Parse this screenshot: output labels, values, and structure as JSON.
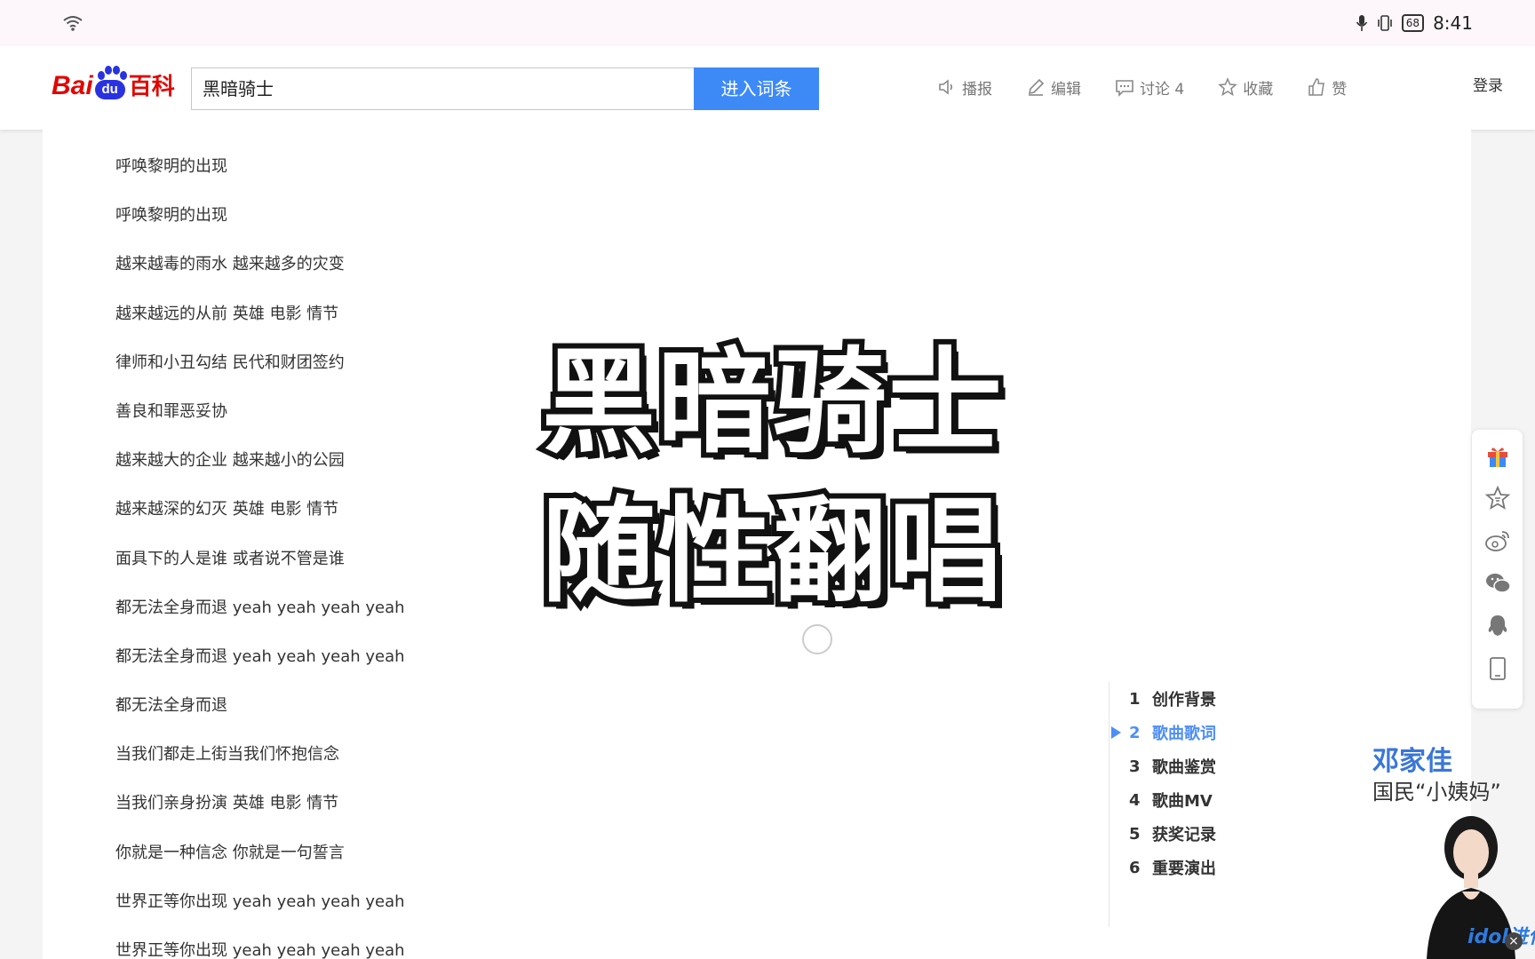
{
  "status_bar": {
    "time": "8:41",
    "battery": "68"
  },
  "header": {
    "logo": {
      "bai": "Bai",
      "du": "du",
      "baike": "百科"
    },
    "search": {
      "value": "黑暗骑士",
      "button_label": "进入词条"
    },
    "tools": [
      {
        "label": "播报",
        "icon": "speaker-icon"
      },
      {
        "label": "编辑",
        "icon": "pencil-icon"
      },
      {
        "label": "讨论 4",
        "icon": "comment-icon"
      },
      {
        "label": "收藏",
        "icon": "star-icon"
      },
      {
        "label": "赞",
        "icon": "thumbs-up-icon"
      }
    ],
    "login": "登录"
  },
  "lyrics": [
    "呼唤黎明的出现",
    "呼唤黎明的出现",
    "越来越毒的雨水 越来越多的灾变",
    "越来越远的从前 英雄 电影 情节",
    "律师和小丑勾结 民代和财团签约",
    "善良和罪恶妥协",
    "越来越大的企业 越来越小的公园",
    "越来越深的幻灭 英雄 电影 情节",
    "面具下的人是谁 或者说不管是谁",
    "都无法全身而退 yeah yeah yeah yeah",
    "都无法全身而退 yeah yeah yeah yeah",
    "都无法全身而退",
    "当我们都走上街当我们怀抱信念",
    "当我们亲身扮演 英雄 电影 情节",
    "你就是一种信念 你就是一句誓言",
    "世界正等你出现 yeah yeah yeah yeah",
    "世界正等你出现 yeah yeah yeah yeah"
  ],
  "overlay": {
    "line1": "黑暗骑士",
    "line2": "随性翻唱"
  },
  "toc": [
    {
      "num": "1",
      "label": "创作背景",
      "active": false
    },
    {
      "num": "2",
      "label": "歌曲歌词",
      "active": true
    },
    {
      "num": "3",
      "label": "歌曲鉴赏",
      "active": false
    },
    {
      "num": "4",
      "label": "歌曲MV",
      "active": false
    },
    {
      "num": "5",
      "label": "获奖记录",
      "active": false
    },
    {
      "num": "6",
      "label": "重要演出",
      "active": false
    }
  ],
  "share_icons": [
    "gift-icon",
    "star-badge-icon",
    "weibo-icon",
    "wechat-icon",
    "qq-icon",
    "tablet-icon"
  ],
  "ad": {
    "name": "邓家佳",
    "tagline": "国民“小姨妈”",
    "badge": "idol进化论"
  },
  "colors": {
    "accent": "#3d8af7",
    "toc_active": "#4e8ef7",
    "brand_red": "#e10601",
    "brand_blue": "#2932e1"
  }
}
